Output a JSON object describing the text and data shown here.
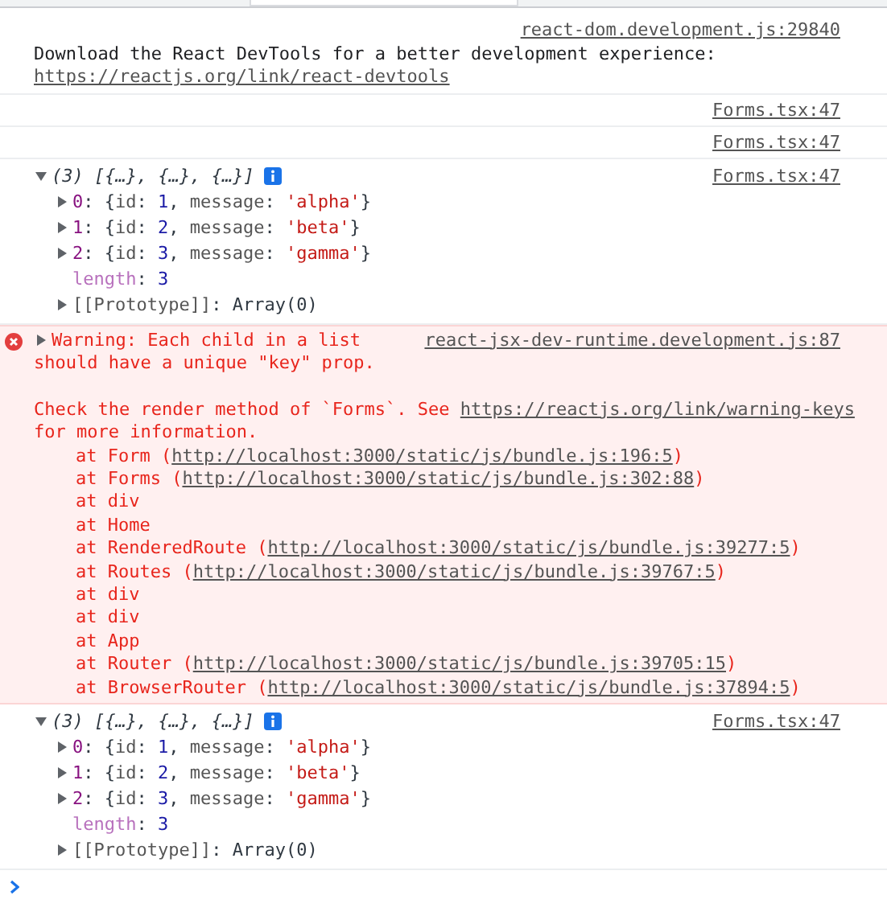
{
  "messages": [
    {
      "kind": "log",
      "source": "react-dom.development.js:29840",
      "text": "Download the React DevTools for a better development experience: ",
      "link": "https://reactjs.org/link/react-devtools"
    },
    {
      "kind": "empty",
      "source": "Forms.tsx:47"
    },
    {
      "kind": "empty",
      "source": "Forms.tsx:47"
    },
    {
      "kind": "object",
      "source": "Forms.tsx:47",
      "expanded": true,
      "count": "(3)",
      "preview": "[{…}, {…}, {…}]",
      "children": [
        {
          "key": "0",
          "kind": "index",
          "expanded": false,
          "parts": [
            {
              "text": ": {",
              "kind": "plain"
            },
            {
              "text": "id",
              "kind": "name"
            },
            {
              "text": ": ",
              "kind": "plain"
            },
            {
              "text": "1",
              "kind": "number"
            },
            {
              "text": ", ",
              "kind": "plain"
            },
            {
              "text": "message",
              "kind": "name"
            },
            {
              "text": ": ",
              "kind": "plain"
            },
            {
              "text": "'alpha'",
              "kind": "string"
            },
            {
              "text": "}",
              "kind": "plain"
            }
          ]
        },
        {
          "key": "1",
          "kind": "index",
          "expanded": false,
          "parts": [
            {
              "text": ": {",
              "kind": "plain"
            },
            {
              "text": "id",
              "kind": "name"
            },
            {
              "text": ": ",
              "kind": "plain"
            },
            {
              "text": "2",
              "kind": "number"
            },
            {
              "text": ", ",
              "kind": "plain"
            },
            {
              "text": "message",
              "kind": "name"
            },
            {
              "text": ": ",
              "kind": "plain"
            },
            {
              "text": "'beta'",
              "kind": "string"
            },
            {
              "text": "}",
              "kind": "plain"
            }
          ]
        },
        {
          "key": "2",
          "kind": "index",
          "expanded": false,
          "parts": [
            {
              "text": ": {",
              "kind": "plain"
            },
            {
              "text": "id",
              "kind": "name"
            },
            {
              "text": ": ",
              "kind": "plain"
            },
            {
              "text": "3",
              "kind": "number"
            },
            {
              "text": ", ",
              "kind": "plain"
            },
            {
              "text": "message",
              "kind": "name"
            },
            {
              "text": ": ",
              "kind": "plain"
            },
            {
              "text": "'gamma'",
              "kind": "string"
            },
            {
              "text": "}",
              "kind": "plain"
            }
          ]
        },
        {
          "key": "length",
          "kind": "property",
          "parts": [
            {
              "text": ": ",
              "kind": "plain"
            },
            {
              "text": "3",
              "kind": "number"
            }
          ]
        },
        {
          "key": "[[Prototype]]",
          "kind": "internal",
          "expanded": false,
          "parts": [
            {
              "text": ": Array(0)",
              "kind": "plain"
            }
          ]
        }
      ]
    },
    {
      "kind": "warning",
      "source": "react-jsx-dev-runtime.development.js:87",
      "expanded": false,
      "message": "Warning: Each child in a list should have a unique \"key\" prop.",
      "detail": {
        "text": "Check the render method of `Forms`. See ",
        "link": "https://reactjs.org/link/warning-keys",
        "after": " for more information."
      },
      "stack": [
        {
          "text": "at Form (",
          "link": "http://localhost:3000/static/js/bundle.js:196:5",
          "after": ")"
        },
        {
          "text": "at Forms (",
          "link": "http://localhost:3000/static/js/bundle.js:302:88",
          "after": ")"
        },
        {
          "text": "at div"
        },
        {
          "text": "at Home"
        },
        {
          "text": "at RenderedRoute (",
          "link": "http://localhost:3000/static/js/bundle.js:39277:5",
          "after": ")"
        },
        {
          "text": "at Routes (",
          "link": "http://localhost:3000/static/js/bundle.js:39767:5",
          "after": ")"
        },
        {
          "text": "at div"
        },
        {
          "text": "at div"
        },
        {
          "text": "at App"
        },
        {
          "text": "at Router (",
          "link": "http://localhost:3000/static/js/bundle.js:39705:15",
          "after": ")"
        },
        {
          "text": "at BrowserRouter (",
          "link": "http://localhost:3000/static/js/bundle.js:37894:5",
          "after": ")"
        }
      ]
    },
    {
      "kind": "object",
      "source": "Forms.tsx:47",
      "expanded": true,
      "count": "(3)",
      "preview": "[{…}, {…}, {…}]",
      "children": [
        {
          "key": "0",
          "kind": "index",
          "expanded": false,
          "parts": [
            {
              "text": ": {",
              "kind": "plain"
            },
            {
              "text": "id",
              "kind": "name"
            },
            {
              "text": ": ",
              "kind": "plain"
            },
            {
              "text": "1",
              "kind": "number"
            },
            {
              "text": ", ",
              "kind": "plain"
            },
            {
              "text": "message",
              "kind": "name"
            },
            {
              "text": ": ",
              "kind": "plain"
            },
            {
              "text": "'alpha'",
              "kind": "string"
            },
            {
              "text": "}",
              "kind": "plain"
            }
          ]
        },
        {
          "key": "1",
          "kind": "index",
          "expanded": false,
          "parts": [
            {
              "text": ": {",
              "kind": "plain"
            },
            {
              "text": "id",
              "kind": "name"
            },
            {
              "text": ": ",
              "kind": "plain"
            },
            {
              "text": "2",
              "kind": "number"
            },
            {
              "text": ", ",
              "kind": "plain"
            },
            {
              "text": "message",
              "kind": "name"
            },
            {
              "text": ": ",
              "kind": "plain"
            },
            {
              "text": "'beta'",
              "kind": "string"
            },
            {
              "text": "}",
              "kind": "plain"
            }
          ]
        },
        {
          "key": "2",
          "kind": "index",
          "expanded": false,
          "parts": [
            {
              "text": ": {",
              "kind": "plain"
            },
            {
              "text": "id",
              "kind": "name"
            },
            {
              "text": ": ",
              "kind": "plain"
            },
            {
              "text": "3",
              "kind": "number"
            },
            {
              "text": ", ",
              "kind": "plain"
            },
            {
              "text": "message",
              "kind": "name"
            },
            {
              "text": ": ",
              "kind": "plain"
            },
            {
              "text": "'gamma'",
              "kind": "string"
            },
            {
              "text": "}",
              "kind": "plain"
            }
          ]
        },
        {
          "key": "length",
          "kind": "property",
          "parts": [
            {
              "text": ": ",
              "kind": "plain"
            },
            {
              "text": "3",
              "kind": "number"
            }
          ]
        },
        {
          "key": "[[Prototype]]",
          "kind": "internal",
          "expanded": false,
          "parts": [
            {
              "text": ": Array(0)",
              "kind": "plain"
            }
          ]
        }
      ]
    }
  ]
}
